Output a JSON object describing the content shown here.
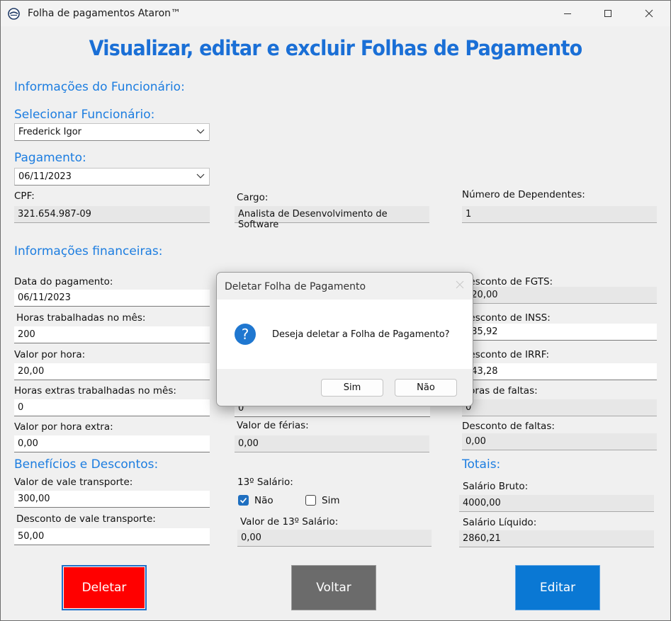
{
  "window": {
    "title": "Folha de pagamentos Ataron™"
  },
  "heading": "Visualizar, editar e excluir Folhas de Pagamento",
  "employee_section": {
    "title": "Informações do Funcionário:",
    "select_label": "Selecionar Funcionário:",
    "select_value": "Frederick Igor",
    "payment_label": "Pagamento:",
    "payment_value": "06/11/2023",
    "cpf_label": "CPF:",
    "cpf_value": "321.654.987-09",
    "cargo_label": "Cargo:",
    "cargo_value": "Analista de Desenvolvimento de Software",
    "dependentes_label": "Número de Dependentes:",
    "dependentes_value": "1"
  },
  "financial_section": {
    "title": "Informações financeiras:",
    "data_pagamento_label": "Data do pagamento:",
    "data_pagamento_value": "06/11/2023",
    "horas_label": "Horas trabalhadas no mês:",
    "horas_value": "200",
    "valor_hora_label": "Valor por hora:",
    "valor_hora_value": "20,00",
    "horas_extras_label": "Horas extras trabalhadas no mês:",
    "horas_extras_value": "0",
    "valor_hora_extra_label": "Valor por hora extra:",
    "valor_hora_extra_value": "0,00",
    "mid_hidden_value": "0",
    "valor_ferias_label": "Valor de férias:",
    "valor_ferias_value": "0,00",
    "fgts_label": "Desconto de FGTS:",
    "fgts_value": "320,00",
    "inss_label": "Desconto de INSS:",
    "inss_value": "335,92",
    "irrf_label": "Desconto de IRRF:",
    "irrf_value": "343,28",
    "faltas_label": "Horas de faltas:",
    "faltas_value": "0",
    "desconto_faltas_label": "Desconto de faltas:",
    "desconto_faltas_value": "0,00"
  },
  "benefits_section": {
    "title": "Benefícios e Descontos:",
    "vt_label": "Valor de vale transporte:",
    "vt_value": "300,00",
    "desconto_vt_label": "Desconto de vale transporte:",
    "desconto_vt_value": "50,00",
    "decimo_label": "13º Salário:",
    "decimo_nao": "Não",
    "decimo_sim": "Sim",
    "decimo_nao_checked": true,
    "valor_decimo_label": "Valor de 13º Salário:",
    "valor_decimo_value": "0,00"
  },
  "totals_section": {
    "title": "Totais:",
    "bruto_label": "Salário Bruto:",
    "bruto_value": "4000,00",
    "liquido_label": "Salário Líquido:",
    "liquido_value": "2860,21"
  },
  "buttons": {
    "deletar": "Deletar",
    "voltar": "Voltar",
    "editar": "Editar"
  },
  "colors": {
    "deletar": "#ff0000",
    "voltar": "#6b6b6b",
    "editar": "#0a78d4",
    "heading": "#1a6fd6",
    "section": "#1c7de0"
  },
  "dialog": {
    "title": "Deletar Folha de Pagamento",
    "message": "Deseja deletar a Folha de Pagamento?",
    "icon": "question-icon",
    "yes": "Sim",
    "no": "Não"
  }
}
